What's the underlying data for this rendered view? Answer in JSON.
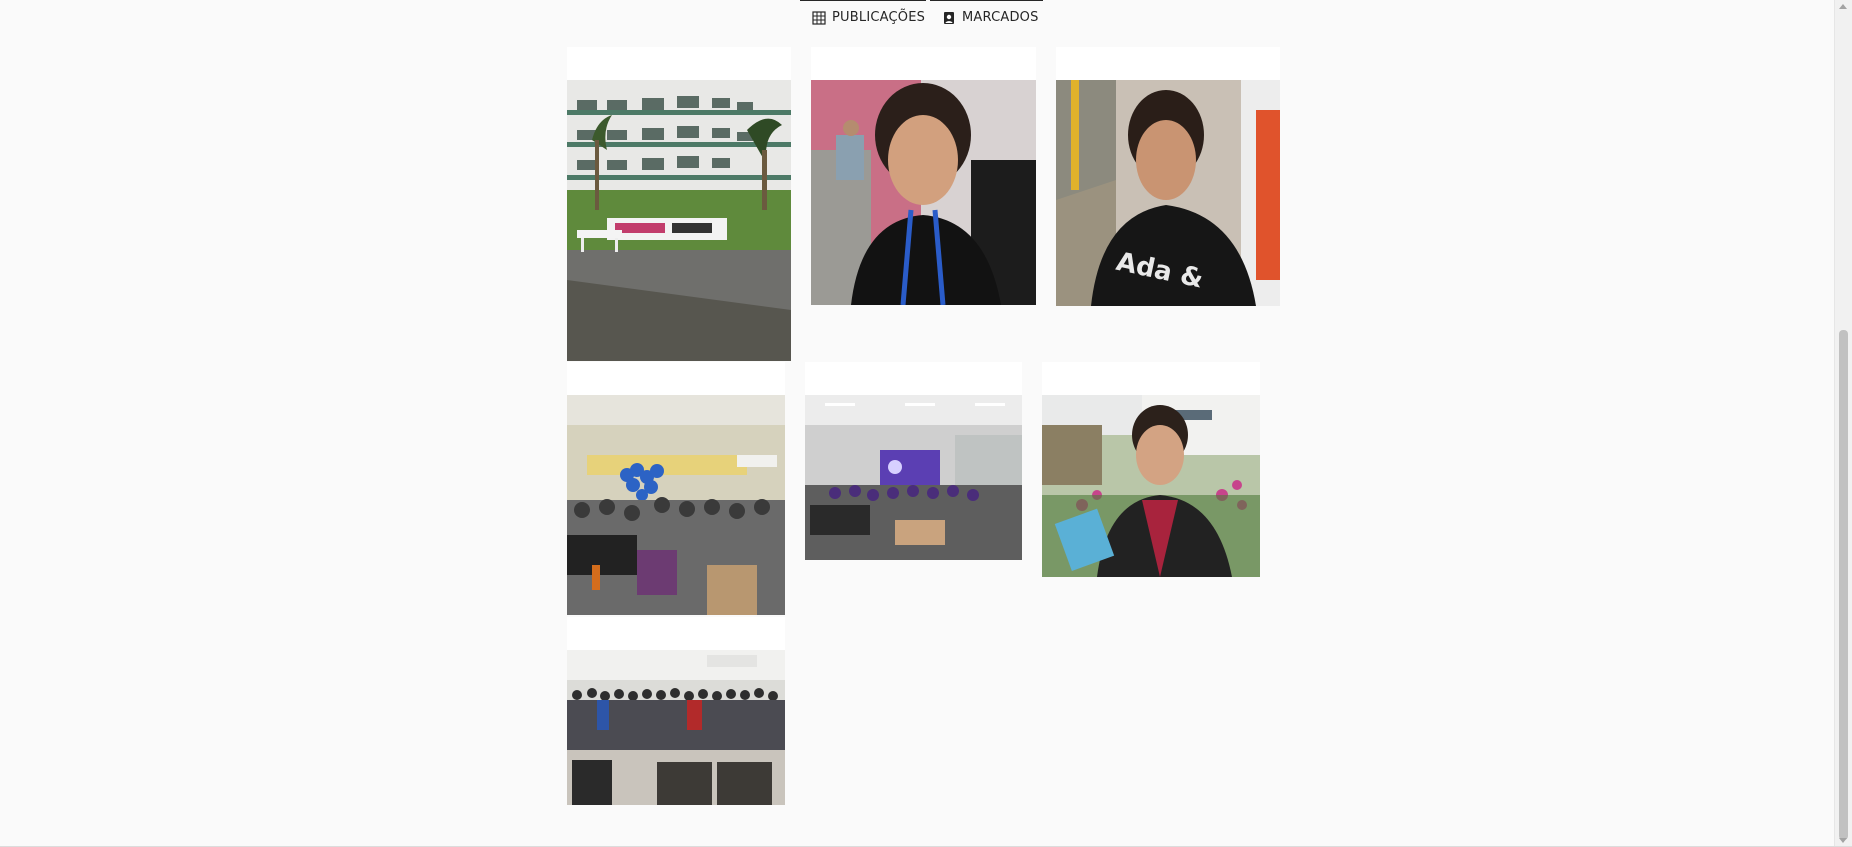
{
  "tabs": [
    {
      "label": "PUBLICAÇÕES",
      "icon": "grid-icon"
    },
    {
      "label": "MARCADOS",
      "icon": "tagged-user-icon"
    }
  ],
  "posts": [
    {
      "subject": "university building with sign"
    },
    {
      "subject": "selfie with lanyard"
    },
    {
      "subject": "selfie in hallway"
    },
    {
      "subject": "group photo with balloons"
    },
    {
      "subject": "group photo with presentation screen"
    },
    {
      "subject": "selfie in garden"
    },
    {
      "subject": "large group photo in lounge"
    }
  ],
  "colors": {
    "background": "#fafafa",
    "text": "#262626",
    "tab_border": "#262626"
  }
}
